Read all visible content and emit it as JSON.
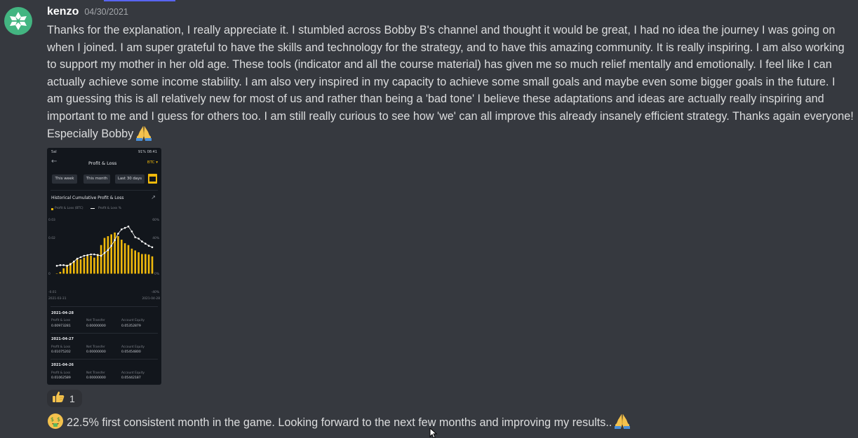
{
  "message": {
    "username": "kenzo",
    "timestamp": "04/30/2021",
    "text": "Thanks for the explanation, I really appreciate it. I stumbled across Bobby B's channel and thought it would be great, I had no idea the journey I was going on when I joined. I am super grateful to have the skills and technology for the strategy, and to have this amazing community. It is really inspiring. I am also working  to support my mother in her old age. These tools (indicator and all the course material) has given me so much relief mentally and emotionally. I feel like I can actually achieve some income stability. I am also very inspired in my capacity to achieve some small goals and maybe even some bigger goals in the future. I am guessing this is all relatively new for most of us and rather than being a 'bad tone' I believe these adaptations and ideas are actually really inspiring and important to me and I guess for others too. I am still really curious to see how 'we' can all improve this already insanely efficient strategy. Thanks again everyone! Especially Bobby",
    "trailing_emoji": "folded-hands-emoji"
  },
  "attachment": {
    "status_left": "5al",
    "status_right": "91% 08:41",
    "title": "Profit & Loss",
    "currency": "BTC ▾",
    "tabs": [
      "This week",
      "This month",
      "Last 30 days"
    ],
    "chart_title": "Historical Cumulative Profit & Loss",
    "legend": [
      "Profit & Loss (BTC)",
      "Profit & Loss %"
    ],
    "y_left": [
      "0.03",
      "0.02",
      "0",
      "-0.01"
    ],
    "y_right": [
      "60%",
      "40%",
      "0%",
      "-40%"
    ],
    "x_start": "2021-03-31",
    "x_end": "2021-04-28",
    "chart_data": {
      "type": "bar",
      "series": [
        {
          "name": "Profit & Loss (BTC)",
          "values": [
            0.0,
            0.001,
            0.003,
            0.005,
            0.006,
            0.007,
            0.008,
            0.008,
            0.009,
            0.01,
            0.01,
            0.009,
            0.011,
            0.016,
            0.02,
            0.021,
            0.022,
            0.023,
            0.021,
            0.019,
            0.017,
            0.016,
            0.014,
            0.013,
            0.012,
            0.011,
            0.011,
            0.0107,
            0.0097
          ]
        },
        {
          "name": "Profit & Loss %",
          "values": [
            -4,
            -3,
            -3,
            -4,
            -2,
            2,
            6,
            8,
            10,
            11,
            12,
            12,
            11,
            10,
            14,
            18,
            24,
            32,
            41,
            47,
            49,
            51,
            44,
            36,
            34,
            30,
            27,
            24,
            22
          ]
        }
      ]
    },
    "entries": [
      {
        "date": "2021-04-28",
        "pnl_label": "Profit & Loss",
        "pnl": "0.00973281",
        "net_label": "Net Transfer",
        "net": "0.00000000",
        "eq_label": "Account Equity",
        "eq": "0.05352879"
      },
      {
        "date": "2021-04-27",
        "pnl_label": "Profit & Loss",
        "pnl": "0.01075202",
        "net_label": "Net Transfer",
        "net": "0.00000000",
        "eq_label": "Account Equity",
        "eq": "0.05454800"
      },
      {
        "date": "2021-04-26",
        "pnl_label": "Profit & Loss",
        "pnl": "0.01062589",
        "net_label": "Net Transfer",
        "net": "0.00000000",
        "eq_label": "Account Equity",
        "eq": "0.05442187"
      }
    ]
  },
  "reaction": {
    "emoji": "thumbs-up-emoji",
    "count": "1"
  },
  "message2": {
    "text": "22.5% first consistent month in the game. Looking forward to the next few months and improving my results..",
    "leading_emoji": "money-mouth-emoji",
    "trailing_emoji": "folded-hands-emoji"
  },
  "colors": {
    "background": "#36393f",
    "bar": "#f0b90b",
    "line": "#ffffff"
  }
}
